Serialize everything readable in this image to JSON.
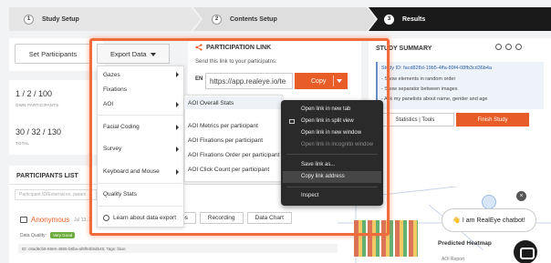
{
  "stepper": {
    "steps": [
      {
        "num": "1",
        "label": "Study Setup"
      },
      {
        "num": "2",
        "label": "Contents Setup"
      },
      {
        "num": "3",
        "label": "Results"
      }
    ]
  },
  "left": {
    "set_participants": "Set Participants",
    "stats": [
      {
        "value": "1 / 2 / 100",
        "label": "OWN PARTICIPANTS"
      },
      {
        "value": "30 / 32 / 130",
        "label": "TOTAL"
      }
    ]
  },
  "export": {
    "button_label": "Export Data",
    "menu": [
      {
        "label": "Gazes",
        "has_sub": true
      },
      {
        "label": "Fixations",
        "has_sub": false
      },
      {
        "label": "AOI",
        "has_sub": true
      },
      {
        "label": "Facial Coding",
        "has_sub": true
      },
      {
        "label": "Survey",
        "has_sub": true
      },
      {
        "label": "Keyboard and Mouse",
        "has_sub": true
      },
      {
        "label": "Quality Stats",
        "has_sub": false
      },
      {
        "label": "Learn about data export",
        "has_sub": false
      }
    ],
    "submenu": [
      "AOI Overall Stats",
      "AOI Metrics per participant",
      "AOI Fixations per participant",
      "AOI Fixations Order per participant",
      "AOI Click Count per participant"
    ]
  },
  "participation": {
    "title": "PARTICIPATION LINK",
    "subtitle": "Send this link to your participatns:",
    "lang": "EN",
    "url": "https://app.realeye.io/te",
    "copy_label": "Copy"
  },
  "context_menu": {
    "items": [
      {
        "label": "Open link in new tab",
        "dim": false
      },
      {
        "label": "Open link in split view",
        "dim": false
      },
      {
        "label": "Open link in new window",
        "dim": false
      },
      {
        "label": "Open link in incognito window",
        "dim": true
      },
      {
        "label": "Save link as...",
        "dim": false
      },
      {
        "label": "Copy link address",
        "dim": false
      },
      {
        "label": "Inspect",
        "dim": false
      }
    ]
  },
  "summary": {
    "title": "STUDY SUMMARY",
    "lines": [
      "Study ID: facd828d-19b5-4ffa-89f4-08fb3cd36b4a",
      "- Show elements in random order",
      "- Show separator between images",
      "- Ask my panelists about name, gender and age"
    ],
    "stats_tools": "Statistics | Tools",
    "finish": "Finish Study"
  },
  "participants": {
    "title": "PARTICIPANTS LIST",
    "search_placeholder": "Participant ID/External ex. param",
    "name": "Anonymous",
    "date": "Jul 13, 2",
    "data_quality_label": "Data Quality:",
    "data_quality": "Very Good",
    "id_row": "ID: c8ad8cb8-69e5-4865-b8ba-af8f94b5d545; Tags: blue;",
    "tabs": [
      "ps",
      "Recording",
      "Data Chart"
    ]
  },
  "heatmap": {
    "title": "Predicted Heatmap",
    "sub": "AOI Report"
  },
  "chatbot": {
    "message": "👋 I am RealEye chatbot!",
    "close": "×"
  }
}
